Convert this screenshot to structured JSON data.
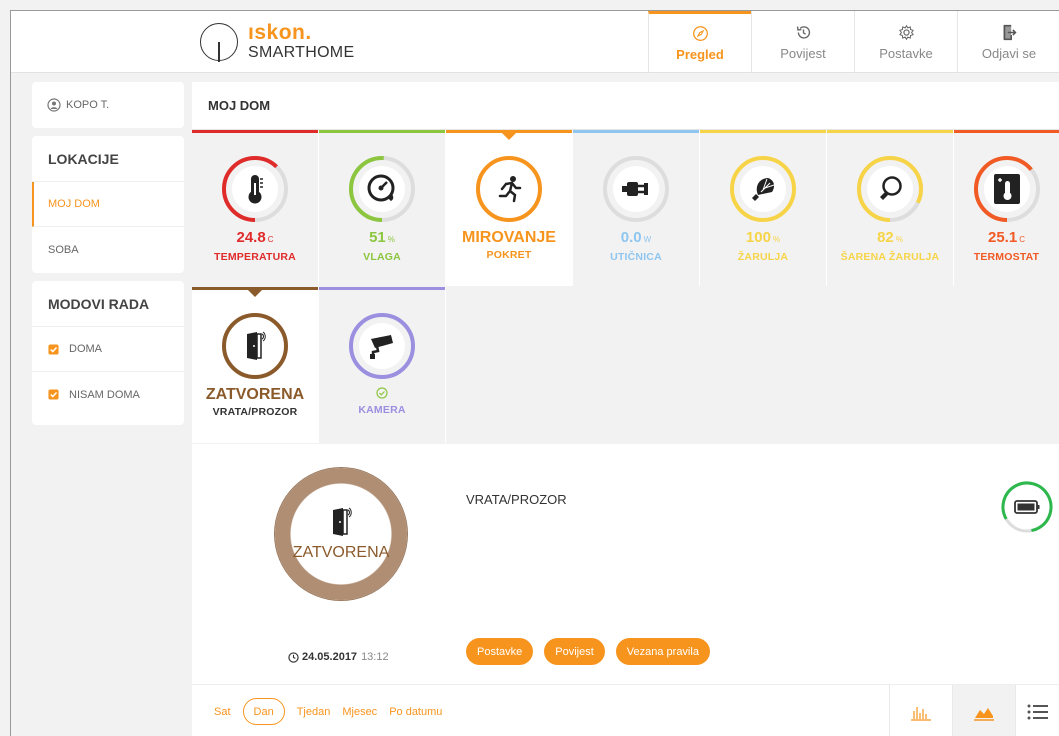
{
  "colors": {
    "accent": "#f7941d",
    "temperature": "#e02b2b",
    "humidity": "#8cc63f",
    "motion": "#f7941d",
    "outlet": "#8ec6f0",
    "bulb": "#f7d447",
    "thermostat": "#f15a24",
    "door": "#8b5a2b",
    "camera": "#9b8fe0",
    "battery": "#2db84d"
  },
  "header": {
    "brand": "ıskon.",
    "product": "SMARTHOME",
    "nav": [
      {
        "label": "Pregled",
        "icon": "compass-icon",
        "active": true
      },
      {
        "label": "Povijest",
        "icon": "history-icon"
      },
      {
        "label": "Postavke",
        "icon": "gear-icon"
      },
      {
        "label": "Odjavi se",
        "icon": "logout-icon"
      }
    ]
  },
  "sidebar": {
    "user": "KOPO T.",
    "locations_title": "LOKACIJE",
    "locations": [
      "MOJ DOM",
      "SOBA"
    ],
    "modes_title": "MODOVI RADA",
    "modes": [
      "DOMA",
      "NISAM DOMA"
    ]
  },
  "main": {
    "title": "MOJ DOM",
    "tiles": [
      {
        "value": "24.8",
        "unit": "C",
        "label": "TEMPERATURA",
        "icon": "thermometer-icon",
        "fill": 0.62
      },
      {
        "value": "51",
        "unit": "%",
        "label": "VLAGA",
        "icon": "humidity-gauge-icon",
        "fill": 0.51
      },
      {
        "value": "MIROVANJE",
        "unit": "",
        "label": "POKRET",
        "icon": "running-person-icon",
        "fill": 1.0
      },
      {
        "value": "0.0",
        "unit": "W",
        "label": "UTIČNICA",
        "icon": "plug-icon",
        "fill": 0.0
      },
      {
        "value": "100",
        "unit": "%",
        "label": "ŽARULJA",
        "icon": "bulb-icon",
        "fill": 1.0
      },
      {
        "value": "82",
        "unit": "%",
        "label": "ŠARENA ŽARULJA",
        "icon": "color-bulb-icon",
        "fill": 0.82
      },
      {
        "value": "25.1",
        "unit": "C",
        "label": "TERMOSTAT",
        "icon": "thermostat-icon",
        "fill": 0.64
      },
      {
        "value": "ZATVORENA",
        "unit": "",
        "label": "VRATA/PROZOR",
        "icon": "door-icon",
        "fill": 1.0
      },
      {
        "value": "",
        "unit": "",
        "label": "KAMERA",
        "icon": "camera-icon",
        "fill": 1.0
      }
    ]
  },
  "detail": {
    "state": "ZATVORENA",
    "name": "VRATA/PROZOR",
    "date": "24.05.2017",
    "time": "13:12",
    "battery_level": 0.8,
    "buttons": [
      "Postavke",
      "Povijest",
      "Vezana pravila"
    ]
  },
  "bottom": {
    "ranges": [
      "Sat",
      "Dan",
      "Tjedan",
      "Mjesec",
      "Po datumu"
    ],
    "active_range": "Dan",
    "views": [
      "bar-chart-icon",
      "area-chart-icon",
      "list-icon"
    ]
  }
}
